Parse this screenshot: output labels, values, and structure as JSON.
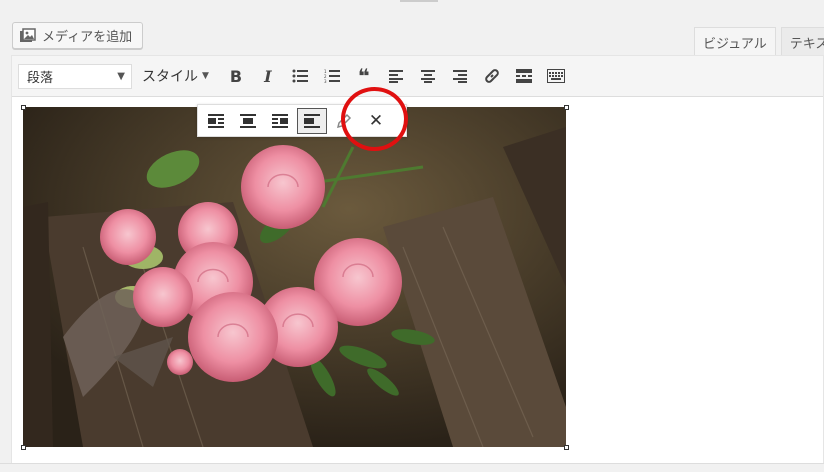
{
  "media_button": {
    "label": "メディアを追加",
    "icon": "add-media-icon"
  },
  "tabs": [
    {
      "label": "ビジュアル",
      "active": true
    },
    {
      "label": "テキス",
      "active": false
    }
  ],
  "toolbar": {
    "format_select": "段落",
    "style_dropdown": "スタイル",
    "buttons": [
      {
        "name": "bold-button",
        "glyph": "B"
      },
      {
        "name": "italic-button",
        "glyph": "I"
      },
      {
        "name": "bullet-list-button",
        "glyph": "☰"
      },
      {
        "name": "numbered-list-button",
        "glyph": "☰"
      },
      {
        "name": "blockquote-button",
        "glyph": "❝"
      },
      {
        "name": "align-left-button",
        "glyph": "≡"
      },
      {
        "name": "align-center-button",
        "glyph": "≡"
      },
      {
        "name": "align-right-button",
        "glyph": "≡"
      },
      {
        "name": "link-button",
        "glyph": "🔗"
      },
      {
        "name": "read-more-button",
        "glyph": "▬"
      },
      {
        "name": "toolbar-toggle-button",
        "glyph": "⌨"
      }
    ]
  },
  "image_toolbar": {
    "buttons": [
      {
        "name": "image-align-left-button",
        "active": false
      },
      {
        "name": "image-align-center-button",
        "active": false
      },
      {
        "name": "image-align-right-button",
        "active": false
      },
      {
        "name": "image-align-none-button",
        "active": true
      },
      {
        "name": "image-edit-button",
        "active": false
      },
      {
        "name": "image-remove-button",
        "glyph": "✕",
        "active": false
      }
    ]
  },
  "colors": {
    "highlight_circle": "#e01010",
    "toolbar_bg": "#f5f5f5"
  }
}
